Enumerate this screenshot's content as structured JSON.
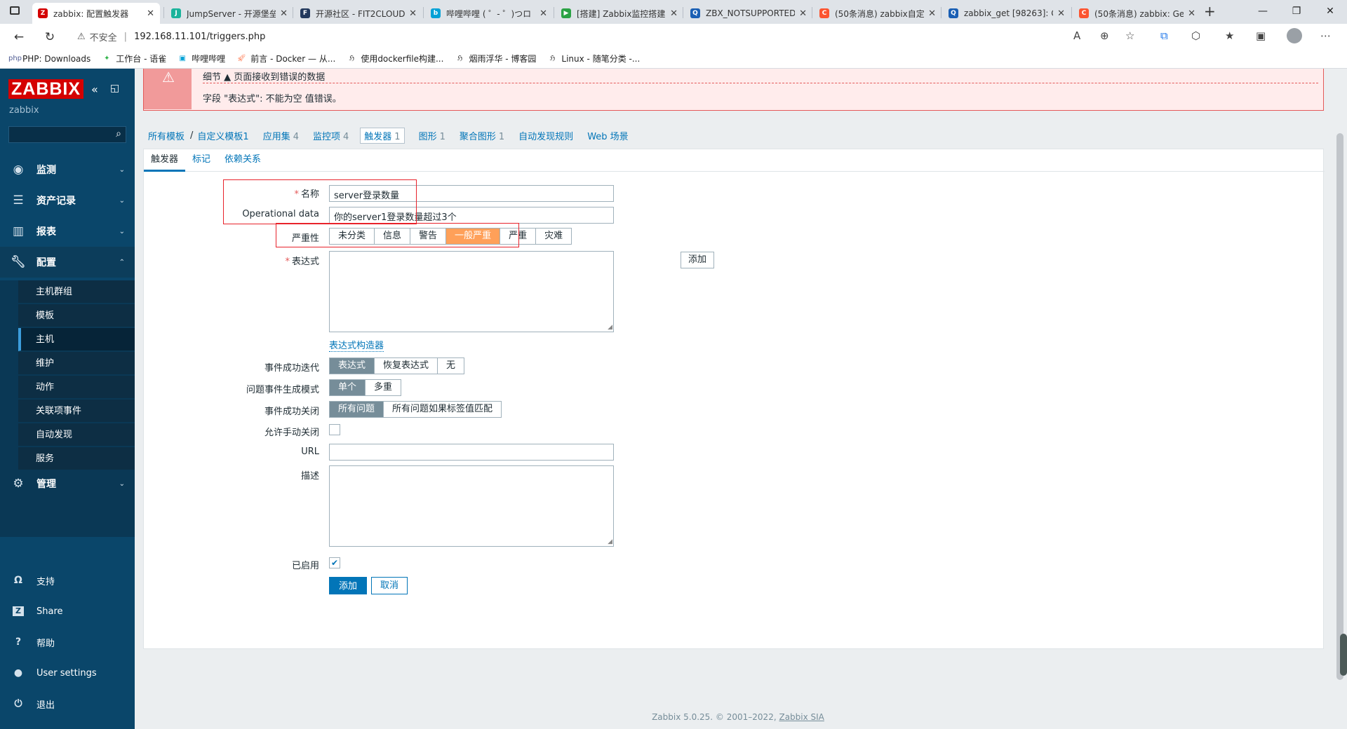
{
  "browser": {
    "tabs": [
      {
        "title": "zabbix: 配置触发器",
        "icon": "zabbix-favicon",
        "color": "#d40000",
        "glyph": "Z"
      },
      {
        "title": "JumpServer - 开源堡垒机",
        "icon": "jumpserver-favicon",
        "color": "#1bb39b",
        "glyph": "J"
      },
      {
        "title": "开源社区 - FIT2CLOUD",
        "icon": "fit2cloud-favicon",
        "color": "#23395d",
        "glyph": "F"
      },
      {
        "title": "哔哩哔哩 ( ゜- ゜)つロ",
        "icon": "bilibili-favicon",
        "color": "#00a1d6",
        "glyph": "b"
      },
      {
        "title": "[搭建] Zabbix监控搭建",
        "icon": "bookmark-favicon",
        "color": "#2ba245",
        "glyph": "▶"
      },
      {
        "title": "ZBX_NOTSUPPORTED",
        "icon": "search-favicon",
        "color": "#1a5fb4",
        "glyph": "Q"
      },
      {
        "title": "(50条消息) zabbix自定",
        "icon": "csdn-favicon",
        "color": "#fc5531",
        "glyph": "C"
      },
      {
        "title": "zabbix_get [98263]: Ge",
        "icon": "search-favicon",
        "color": "#1a5fb4",
        "glyph": "Q"
      },
      {
        "title": "(50条消息) zabbix: Ge",
        "icon": "csdn-favicon",
        "color": "#fc5531",
        "glyph": "C"
      }
    ],
    "new_tab": "+",
    "insecure_label": "不安全",
    "url": "192.168.11.101/triggers.php",
    "bookmarks": [
      {
        "label": "PHP: Downloads",
        "icon": "php-icon"
      },
      {
        "label": "工作台 - 语雀",
        "icon": "yuque-icon"
      },
      {
        "label": "哔哩哔哩",
        "icon": "bilibili-icon"
      },
      {
        "label": "前言 - Docker — 从...",
        "icon": "rocket-icon"
      },
      {
        "label": "使用dockerfile构建...",
        "icon": "cnblogs-icon"
      },
      {
        "label": "烟雨浮华 - 博客园",
        "icon": "cnblogs-icon"
      },
      {
        "label": "Linux - 随笔分类 -...",
        "icon": "cnblogs-icon"
      }
    ]
  },
  "sidebar": {
    "logo": "ZABBIX",
    "user": "zabbix",
    "menu": [
      {
        "label": "监测",
        "icon": "eye-icon"
      },
      {
        "label": "资产记录",
        "icon": "list-icon"
      },
      {
        "label": "报表",
        "icon": "chart-icon"
      },
      {
        "label": "配置",
        "icon": "wrench-icon"
      },
      {
        "label": "管理",
        "icon": "gear-icon"
      }
    ],
    "config_items": [
      "主机群组",
      "模板",
      "主机",
      "维护",
      "动作",
      "关联项事件",
      "自动发现",
      "服务"
    ],
    "bottom": [
      {
        "label": "支持",
        "icon": "headset-icon"
      },
      {
        "label": "Share",
        "icon": "share-icon"
      },
      {
        "label": "帮助",
        "icon": "help-icon"
      },
      {
        "label": "User settings",
        "icon": "user-icon"
      },
      {
        "label": "退出",
        "icon": "power-icon"
      }
    ]
  },
  "error": {
    "line1": "细节 ▲  页面接收到错误的数据",
    "line2": "字段 \"表达式\": 不能为空 值错误。"
  },
  "breadcrumbs": {
    "all_templates": "所有模板",
    "separator": "/",
    "template": "自定义模板1",
    "items": [
      {
        "label": "应用集",
        "count": "4"
      },
      {
        "label": "监控项",
        "count": "4"
      },
      {
        "label": "触发器",
        "count": "1"
      },
      {
        "label": "图形",
        "count": "1"
      },
      {
        "label": "聚合图形",
        "count": "1"
      },
      {
        "label": "自动发现规则",
        "count": ""
      },
      {
        "label": "Web 场景",
        "count": ""
      }
    ]
  },
  "form_tabs": [
    "触发器",
    "标记",
    "依赖关系"
  ],
  "form": {
    "name_label": "名称",
    "name_value": "server登录数量",
    "opdata_label": "Operational data",
    "opdata_value": "你的server1登录数量超过3个",
    "severity_label": "严重性",
    "severities": [
      "未分类",
      "信息",
      "警告",
      "一般严重",
      "严重",
      "灾难"
    ],
    "severity_selected": "一般严重",
    "severity_color": "#ffa059",
    "expression_label": "表达式",
    "add_button": "添加",
    "expr_builder": "表达式构造器",
    "ok_event_label": "事件成功迭代",
    "ok_event_options": [
      "表达式",
      "恢复表达式",
      "无"
    ],
    "mode_label": "问题事件生成模式",
    "mode_options": [
      "单个",
      "多重"
    ],
    "close_label": "事件成功关闭",
    "close_options": [
      "所有问题",
      "所有问题如果标签值匹配"
    ],
    "manual_close_label": "允许手动关闭",
    "url_label": "URL",
    "desc_label": "描述",
    "enabled_label": "已启用",
    "enabled": true,
    "submit": "添加",
    "cancel": "取消"
  },
  "footer": {
    "text": "Zabbix 5.0.25. © 2001–2022, ",
    "link": "Zabbix SIA"
  }
}
